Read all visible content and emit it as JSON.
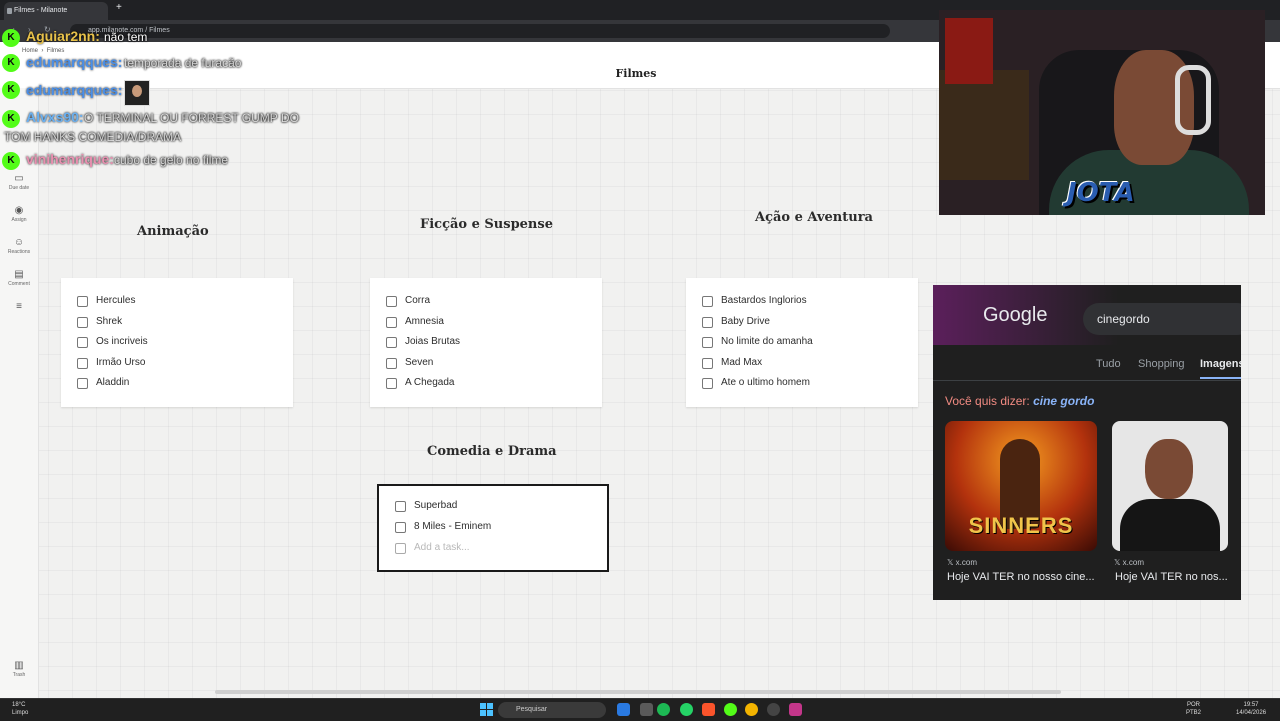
{
  "browser": {
    "tab_title": "Filmes - Milanote",
    "new_tab_glyph": "+",
    "url": "app.milanote.com / Filmes"
  },
  "app": {
    "breadcrumb_home": "Home",
    "breadcrumb_board": "Filmes",
    "board_title": "Filmes",
    "sidebar": [
      {
        "label": "Due date",
        "icon": "calendar-icon"
      },
      {
        "label": "Assign",
        "icon": "person-icon"
      },
      {
        "label": "Reactions",
        "icon": "reaction-icon"
      },
      {
        "label": "Comment",
        "icon": "comment-icon"
      },
      {
        "label": "",
        "icon": "list-icon"
      }
    ],
    "trash_label": "Trash",
    "columns": [
      {
        "heading": "Animação",
        "tasks": [
          "Hercules",
          "Shrek",
          "Os incriveis",
          "Irmão Urso",
          "Aladdin"
        ]
      },
      {
        "heading": "Ficção e Suspense",
        "tasks": [
          "Corra",
          "Amnesia",
          "Joias Brutas",
          "Seven",
          "A Chegada"
        ]
      },
      {
        "heading": "Ação e Aventura",
        "tasks": [
          "Bastardos Inglorios",
          "Baby Drive",
          "No limite do amanha",
          "Mad Max",
          "Ate o ultimo homem"
        ]
      },
      {
        "heading": "Comedia e Drama",
        "tasks": [
          "Superbad",
          "8 Miles - Eminem"
        ],
        "placeholder": "Add a task..."
      }
    ]
  },
  "chat": [
    {
      "user": "Aguiar2nn:",
      "message": "não tem",
      "user_color": "#e8c24a"
    },
    {
      "user": "edumarqques:",
      "message": "temporada de furacão",
      "user_color": "#4a8fe8"
    },
    {
      "user": "edumarqques:",
      "message": "",
      "user_color": "#4a8fe8",
      "emote": true
    },
    {
      "user": "Alvxs90:",
      "message": "O TERMINAL OU FORREST GUMP DO",
      "message2": "TOM HANKS COMEDIA/DRAMA",
      "user_color": "#6ab0f0"
    },
    {
      "user": "vinihenrique:",
      "message": "cubo de gelo no filme",
      "user_color": "#e890b0"
    }
  ],
  "chat_badge": "K",
  "webcam": {
    "logo_text": "JOTA"
  },
  "google": {
    "logo": "Google",
    "query": "cinegordo",
    "tabs": [
      "Tudo",
      "Shopping",
      "Imagens"
    ],
    "active_tab": "Imagens",
    "suggest_prefix": "Você quis dizer:",
    "suggest_term": "cine gordo",
    "results": [
      {
        "source": "x.com",
        "caption": "Hoje VAI TER no nosso cine...",
        "poster_text": "SINNERS"
      },
      {
        "source": "x.com",
        "caption": "Hoje VAI TER no nos..."
      }
    ]
  },
  "taskbar": {
    "temperature": "18°C",
    "weather": "Limpo",
    "search_placeholder": "Pesquisar",
    "lang": "POR",
    "layout": "PTB2",
    "time": "19:57",
    "date": "14/04/2026"
  },
  "colors": {
    "accent_green": "#53fc18",
    "start_blue": "#4cc2ff"
  }
}
